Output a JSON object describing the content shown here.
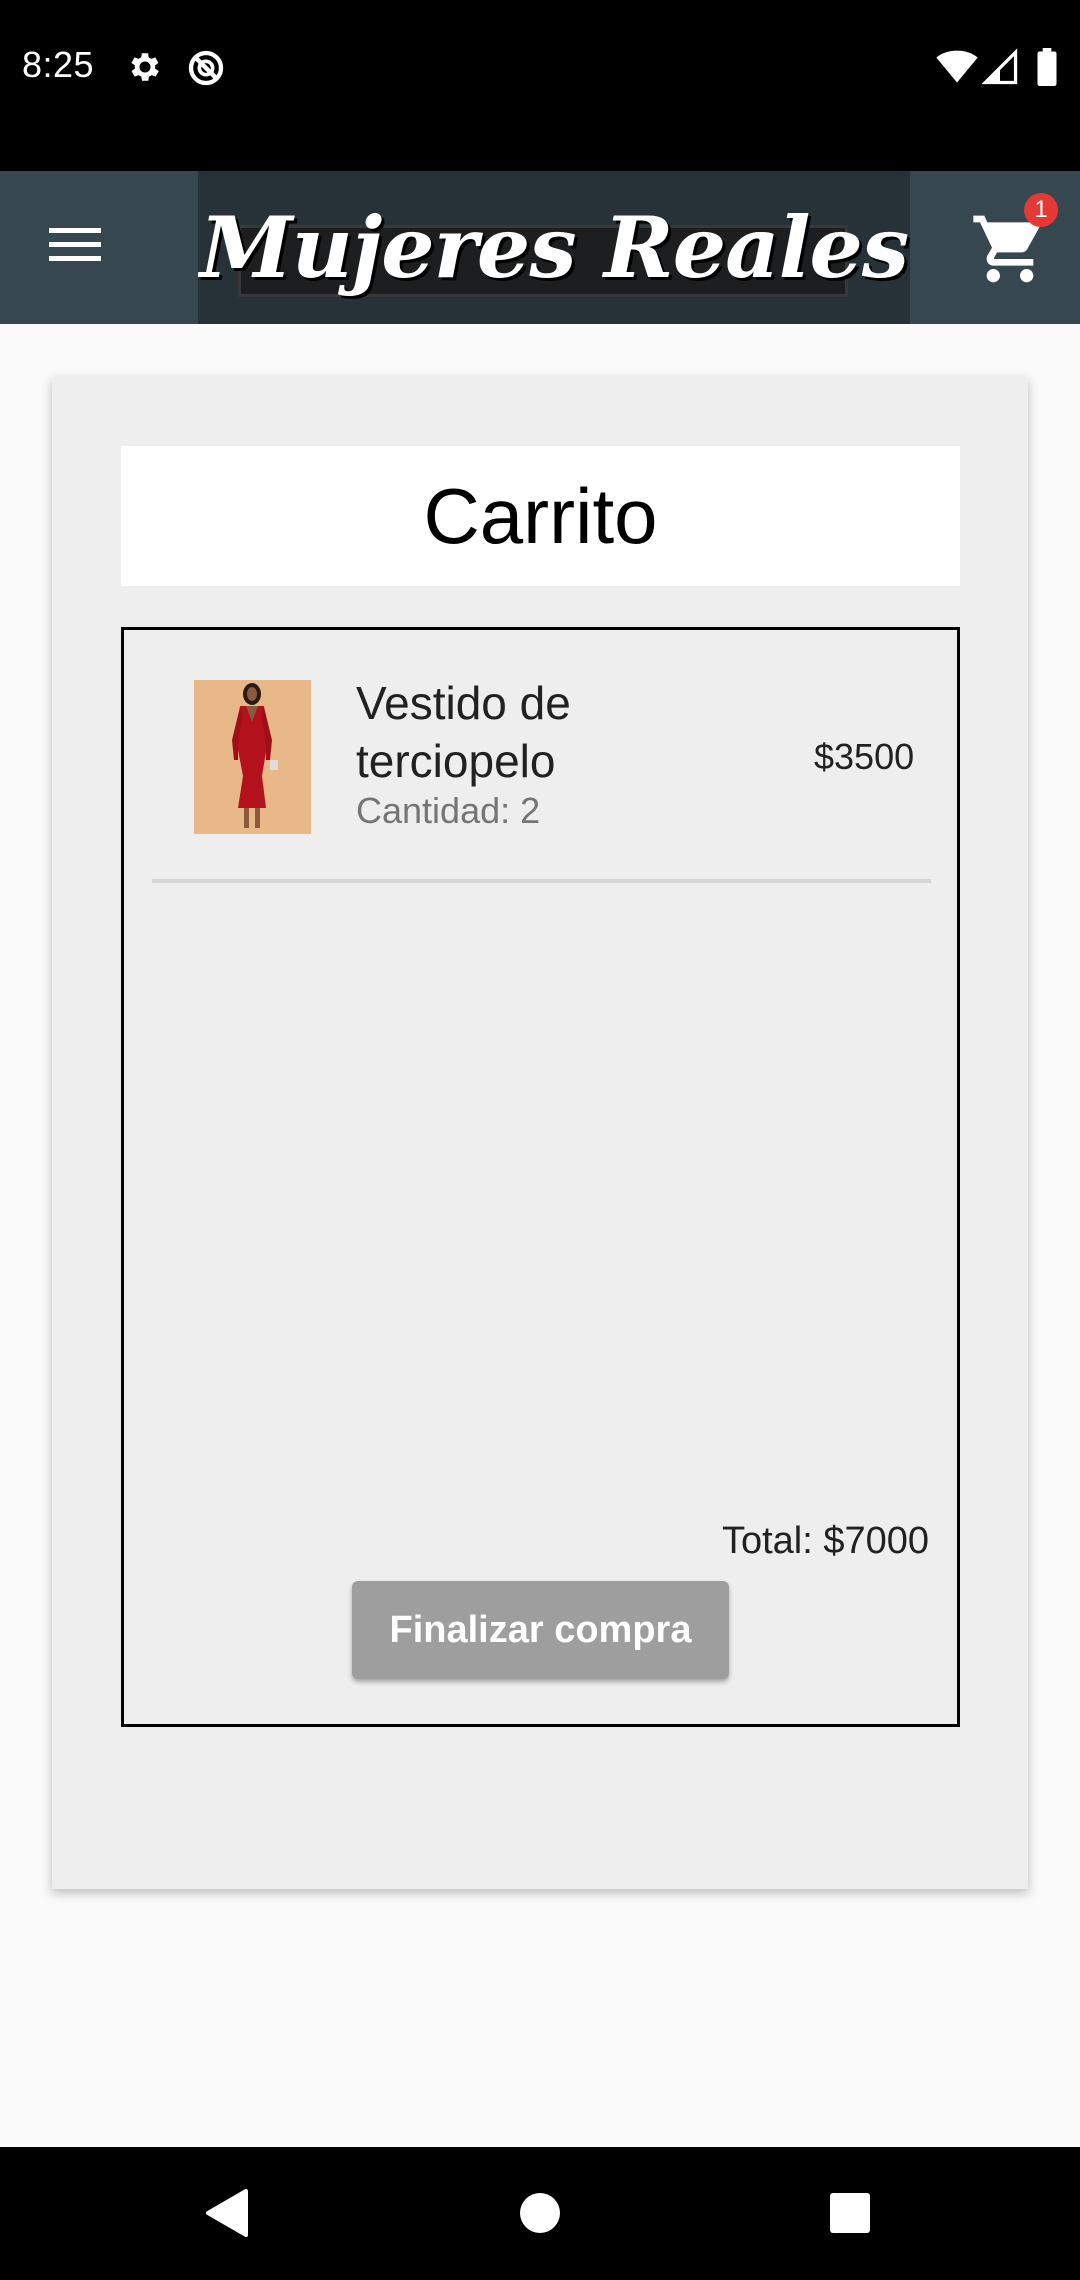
{
  "status_bar": {
    "time": "8:25"
  },
  "app_bar": {
    "logo_text": "Mujeres Reales",
    "cart_badge_count": "1"
  },
  "cart": {
    "title": "Carrito",
    "items": [
      {
        "name": "Vestido de terciopelo",
        "quantity_label": "Cantidad: 2",
        "price": "$3500"
      }
    ],
    "total_label": "Total: $7000",
    "checkout_label": "Finalizar compra"
  },
  "colors": {
    "app_bar": "#37474f",
    "logo_bg": "#263238",
    "badge": "#e53935",
    "card_bg": "#eeeeee",
    "checkout_button": "#9e9e9e"
  },
  "icons": [
    "settings-icon",
    "blocked-icon",
    "wifi-icon",
    "signal-icon",
    "battery-icon",
    "menu-icon",
    "cart-icon",
    "back-icon",
    "home-icon",
    "recents-icon"
  ]
}
